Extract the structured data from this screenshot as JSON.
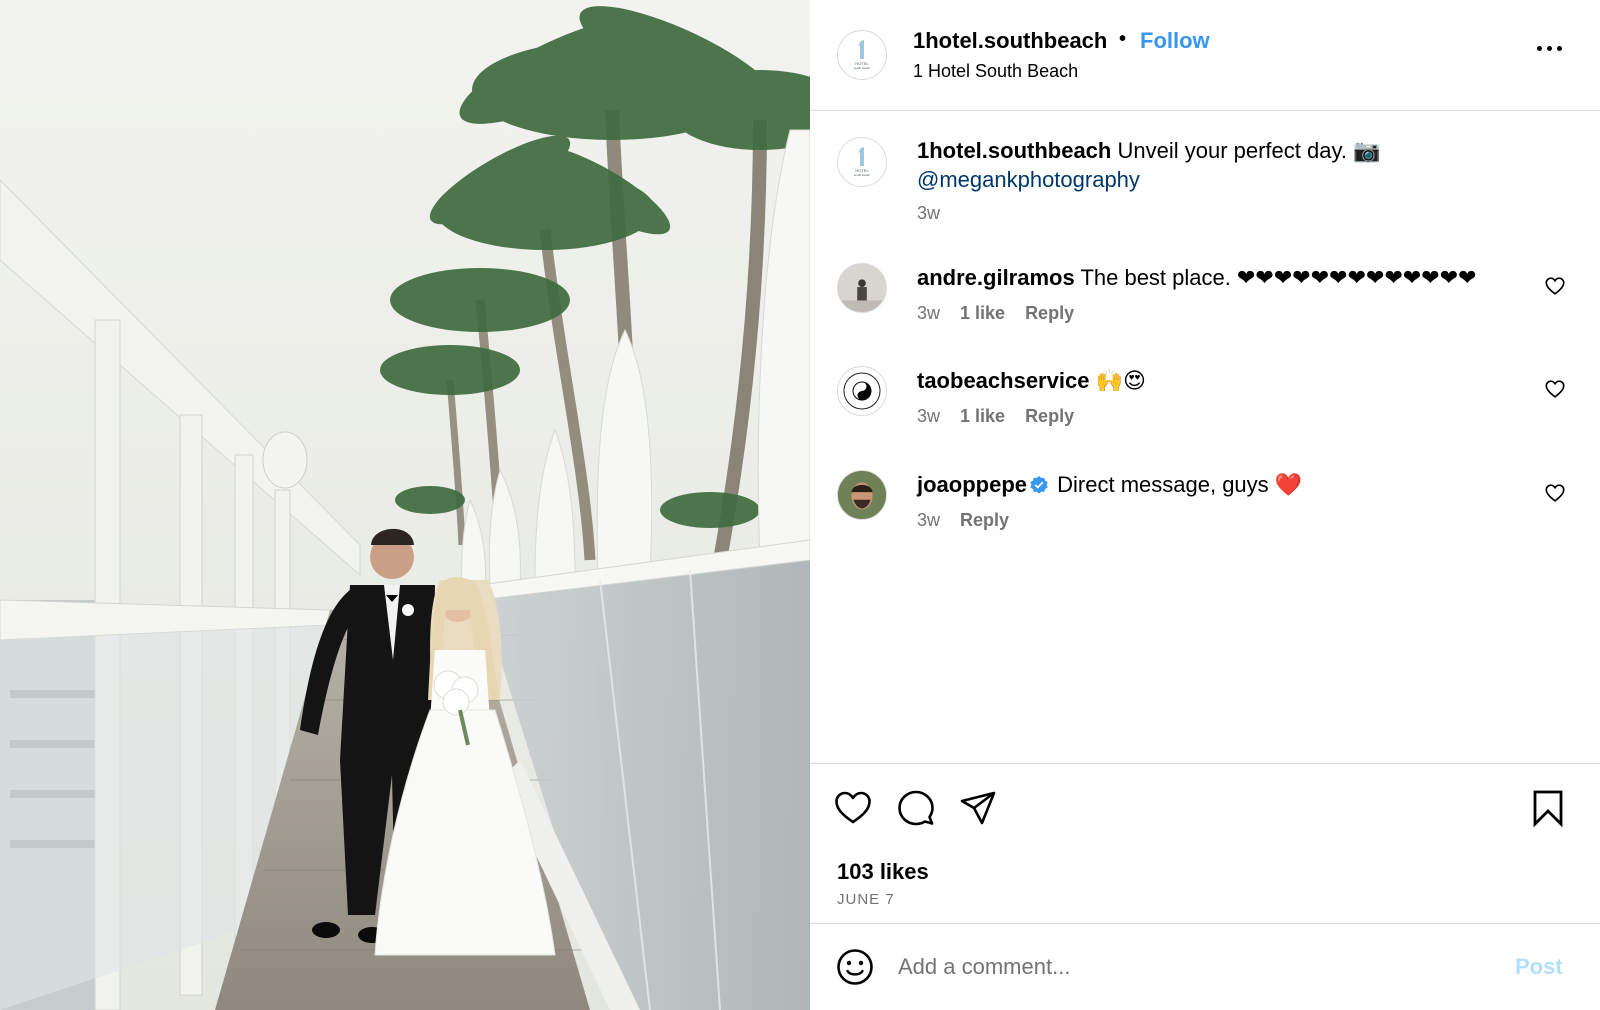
{
  "post": {
    "image_description_icon": "wedding-photo",
    "account": {
      "username": "1hotel.southbeach",
      "separator": "•",
      "follow_label": "Follow",
      "location": "1 Hotel South Beach",
      "avatar_icon": "1-hotel-logo-icon"
    },
    "caption": {
      "username": "1hotel.southbeach",
      "text": "Unveil your perfect day. 📷",
      "mention": "@megankphotography",
      "time": "3w"
    },
    "comments": [
      {
        "username": "andre.gilramos",
        "text": "The best place. ❤❤❤❤❤❤❤❤❤❤❤❤❤",
        "time": "3w",
        "likes": "1 like",
        "reply": "Reply",
        "verified": false
      },
      {
        "username": "taobeachservice",
        "text": "🙌😍",
        "time": "3w",
        "likes": "1 like",
        "reply": "Reply",
        "verified": false
      },
      {
        "username": "joaoppepe",
        "text": "Direct message, guys ❤️",
        "time": "3w",
        "likes": "",
        "reply": "Reply",
        "verified": true
      }
    ],
    "likes_count": "103 likes",
    "date": "JUNE 7",
    "composer": {
      "placeholder": "Add a comment...",
      "post_label": "Post"
    },
    "colors": {
      "link_blue": "#3896f0",
      "mention_blue": "#00376b",
      "muted_text": "#737373",
      "divider": "#dbdbdb",
      "post_disabled": "#b2dffc"
    }
  }
}
